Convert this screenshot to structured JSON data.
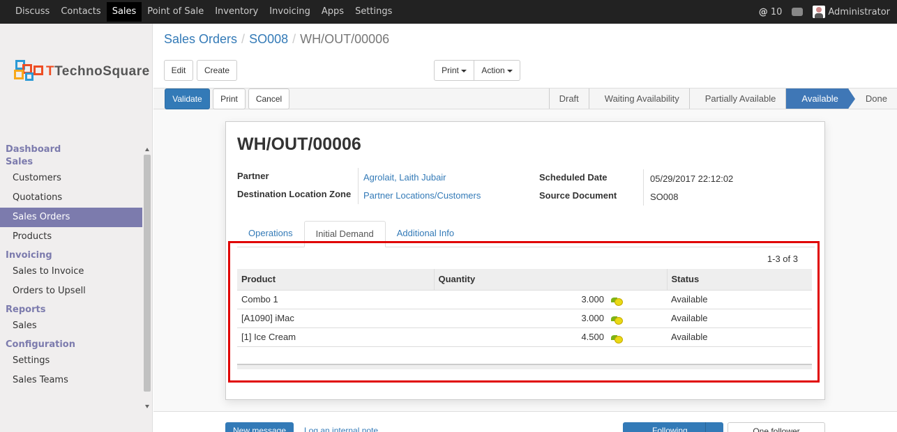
{
  "topbar": {
    "menu": [
      {
        "label": "Discuss"
      },
      {
        "label": "Contacts"
      },
      {
        "label": "Sales",
        "active": true
      },
      {
        "label": "Point of Sale"
      },
      {
        "label": "Inventory"
      },
      {
        "label": "Invoicing"
      },
      {
        "label": "Apps"
      },
      {
        "label": "Settings"
      }
    ],
    "mentions_count": "10",
    "user_name": "Administrator"
  },
  "logo": {
    "part1": "Techno",
    "part2": "Square"
  },
  "sidebar": {
    "sections": [
      {
        "title": "Dashboard"
      },
      {
        "title": "Sales",
        "items": [
          "Customers",
          "Quotations",
          "Sales Orders",
          "Products"
        ]
      },
      {
        "title": "Invoicing",
        "items": [
          "Sales to Invoice",
          "Orders to Upsell"
        ]
      },
      {
        "title": "Reports",
        "items": [
          "Sales"
        ]
      },
      {
        "title": "Configuration",
        "items": [
          "Settings",
          "Sales Teams"
        ]
      }
    ],
    "active_item": "Sales Orders"
  },
  "breadcrumb": {
    "items": [
      "Sales Orders",
      "SO008"
    ],
    "current": "WH/OUT/00006"
  },
  "buttons": {
    "edit": "Edit",
    "create": "Create",
    "print_menu": "Print",
    "action_menu": "Action",
    "validate": "Validate",
    "print": "Print",
    "cancel": "Cancel"
  },
  "statusbar": {
    "stages": [
      "Draft",
      "Waiting Availability",
      "Partially Available",
      "Available",
      "Done"
    ],
    "active": "Available",
    "active_color": "#3f77b6"
  },
  "form": {
    "title": "WH/OUT/00006",
    "fields": {
      "partner_label": "Partner",
      "partner_value": "Agrolait, Laith Jubair",
      "dest_label": "Destination Location Zone",
      "dest_value": "Partner Locations/Customers",
      "sched_label": "Scheduled Date",
      "sched_value": "05/29/2017 22:12:02",
      "source_label": "Source Document",
      "source_value": "SO008"
    },
    "tabs": [
      "Operations",
      "Initial Demand",
      "Additional Info"
    ],
    "active_tab": "Initial Demand",
    "pager": "1-3 of 3",
    "columns": [
      "Product",
      "Quantity",
      "Status"
    ],
    "rows": [
      {
        "product": "Combo 1",
        "quantity": "3.000",
        "status": "Available"
      },
      {
        "product": "[A1090] iMac",
        "quantity": "3.000",
        "status": "Available"
      },
      {
        "product": "[1] Ice Cream",
        "quantity": "4.500",
        "status": "Available"
      }
    ],
    "highlight_color": "#e00000"
  },
  "chatter": {
    "new_message": "New message",
    "log_note": "Log an internal note",
    "following": "Following",
    "followers": "One follower"
  }
}
